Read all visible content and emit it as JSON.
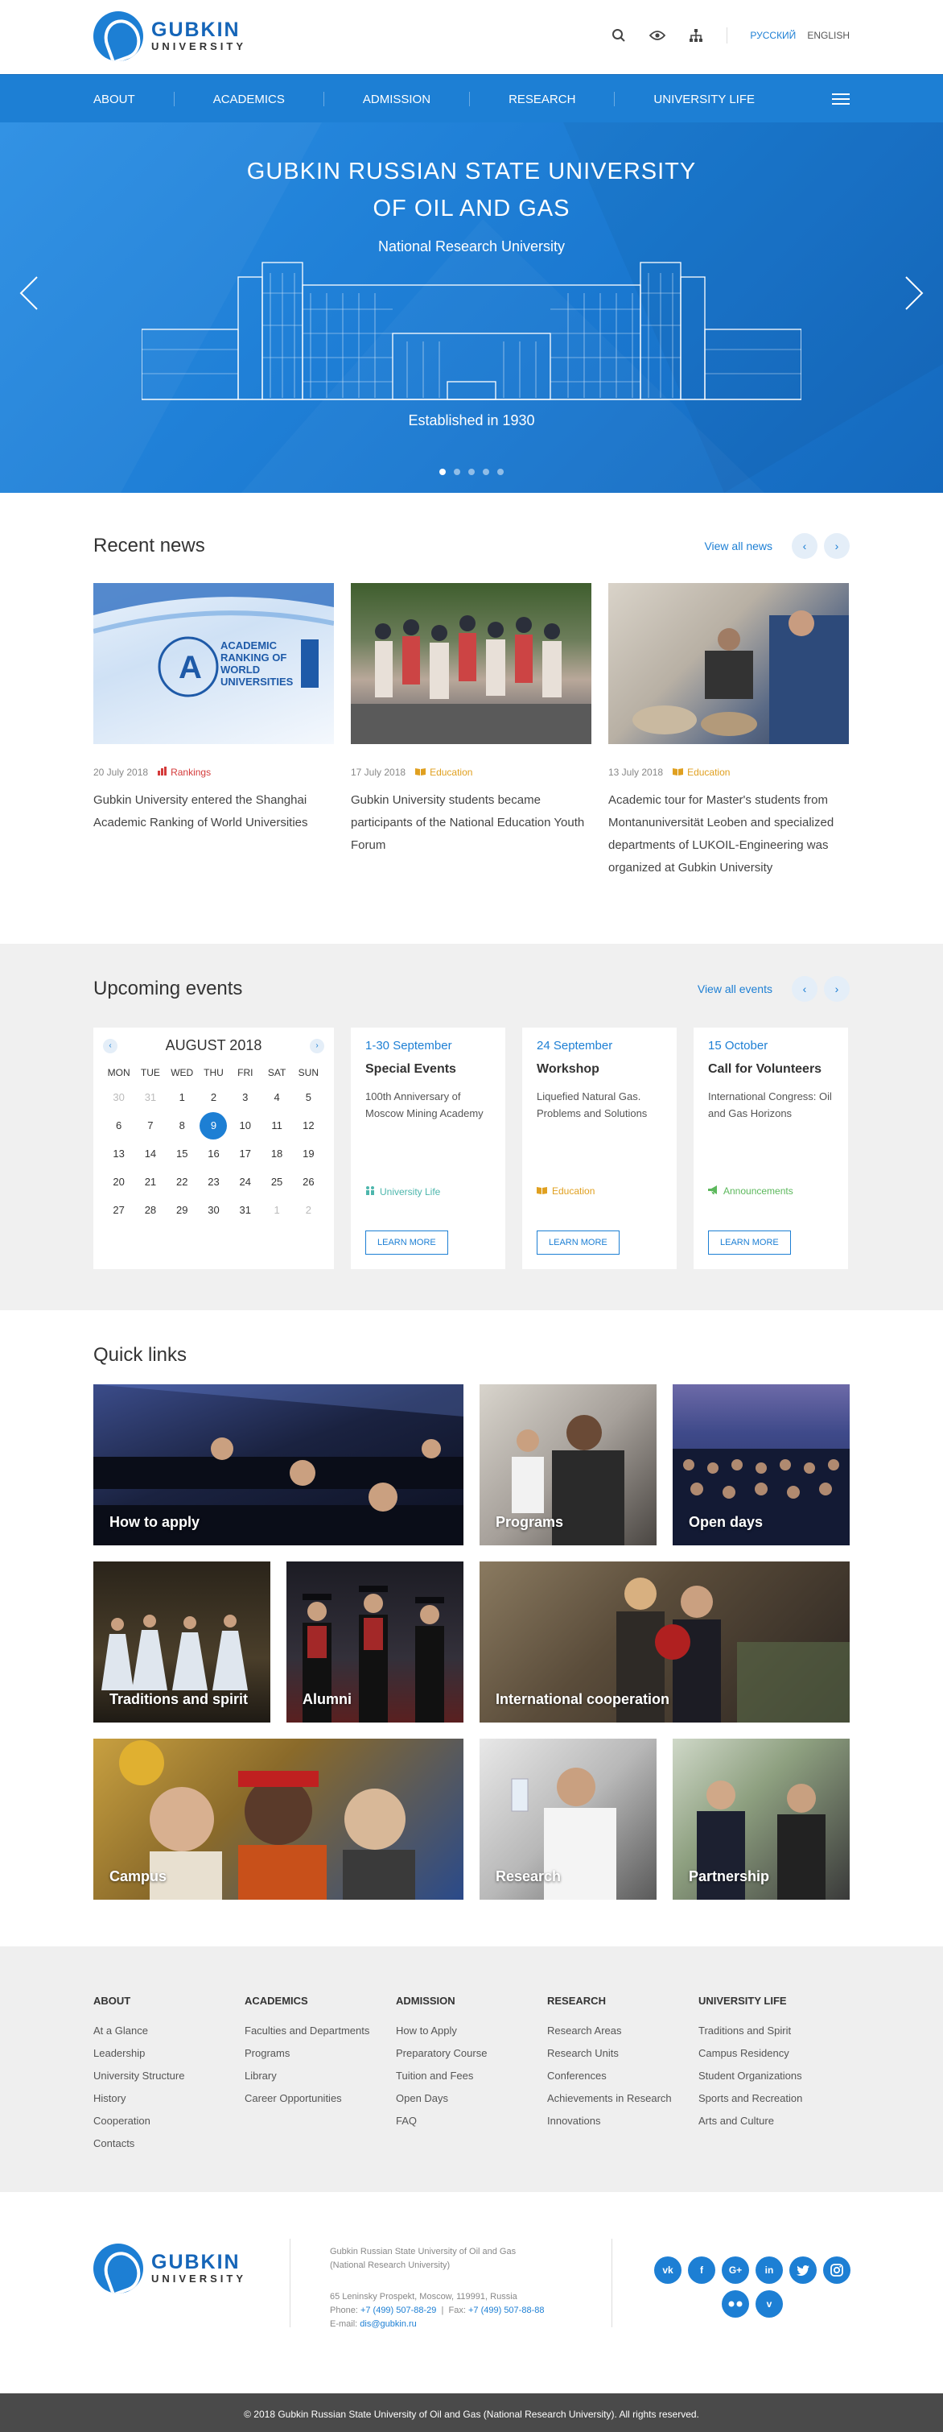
{
  "header": {
    "logo_line1": "GUBKIN",
    "logo_line2": "UNIVERSITY",
    "lang_ru": "РУССКИЙ",
    "lang_en": "ENGLISH"
  },
  "nav": [
    "ABOUT",
    "ACADEMICS",
    "ADMISSION",
    "RESEARCH",
    "UNIVERSITY LIFE"
  ],
  "hero": {
    "title_line1": "GUBKIN RUSSIAN STATE UNIVERSITY",
    "title_line2": "OF OIL AND GAS",
    "subtitle": "National Research University",
    "established": "Established in 1930",
    "slides": 5,
    "active_slide": 1
  },
  "news": {
    "heading": "Recent news",
    "view_all": "View all news",
    "items": [
      {
        "date": "20 July 2018",
        "category": "Rankings",
        "cat_color": "#d43a3a",
        "title": "Gubkin University entered the Shanghai Academic Ranking of World Universities",
        "img_text": "ACADEMIC RANKING OF WORLD UNIVERSITIES"
      },
      {
        "date": "17 July 2018",
        "category": "Education",
        "cat_color": "#e0a020",
        "title": "Gubkin University students became participants of the National Education Youth Forum"
      },
      {
        "date": "13 July 2018",
        "category": "Education",
        "cat_color": "#e0a020",
        "title": "Academic tour for Master's students from Montanuniversität Leoben and specialized departments of LUKOIL-Engineering was organized at Gubkin University"
      }
    ]
  },
  "events": {
    "heading": "Upcoming events",
    "view_all": "View all events",
    "calendar": {
      "month": "AUGUST 2018",
      "dow": [
        "MON",
        "TUE",
        "WED",
        "THU",
        "FRI",
        "SAT",
        "SUN"
      ],
      "days": [
        "30",
        "31",
        "1",
        "2",
        "3",
        "4",
        "5",
        "6",
        "7",
        "8",
        "9",
        "10",
        "11",
        "12",
        "13",
        "14",
        "15",
        "16",
        "17",
        "18",
        "19",
        "20",
        "21",
        "22",
        "23",
        "24",
        "25",
        "26",
        "27",
        "28",
        "29",
        "30",
        "31",
        "1",
        "2"
      ],
      "today": "9"
    },
    "items": [
      {
        "date": "1-30 September",
        "name": "Special Events",
        "desc": "100th Anniversary of Moscow Mining Academy",
        "category": "University Life",
        "cat_color": "#4db6ac",
        "button": "LEARN MORE"
      },
      {
        "date": "24 September",
        "name": "Workshop",
        "desc": "Liquefied Natural Gas. Problems and Solutions",
        "category": "Education",
        "cat_color": "#e0a020",
        "button": "LEARN MORE"
      },
      {
        "date": "15 October",
        "name": "Call for Volunteers",
        "desc": "International Congress: Oil and Gas Horizons",
        "category": "Announcements",
        "cat_color": "#5cb85c",
        "button": "LEARN MORE"
      }
    ]
  },
  "quick_links": {
    "heading": "Quick links",
    "items": [
      "How to apply",
      "Programs",
      "Open days",
      "Traditions and spirit",
      "Alumni",
      "International cooperation",
      "Campus",
      "Research",
      "Partnership"
    ]
  },
  "footer_nav": [
    {
      "title": "ABOUT",
      "links": [
        "At a Glance",
        "Leadership",
        "University Structure",
        "History",
        "Cooperation",
        "Contacts"
      ]
    },
    {
      "title": "ACADEMICS",
      "links": [
        "Faculties and Departments",
        "Programs",
        "Library",
        "Career Opportunities"
      ]
    },
    {
      "title": "ADMISSION",
      "links": [
        "How to Apply",
        "Preparatory Course",
        "Tuition and Fees",
        "Open Days",
        "FAQ"
      ]
    },
    {
      "title": "RESEARCH",
      "links": [
        "Research Areas",
        "Research Units",
        "Conferences",
        "Achievements in Research",
        "Innovations"
      ]
    },
    {
      "title": "UNIVERSITY LIFE",
      "links": [
        "Traditions and Spirit",
        "Campus Residency",
        "Student Organizations",
        "Sports and Recreation",
        "Arts and Culture"
      ]
    }
  ],
  "footer_info": {
    "org_line1": "Gubkin Russian State University of Oil and Gas",
    "org_line2": "(National Research University)",
    "address": "65 Leninsky Prospekt, Moscow, 119991, Russia",
    "phone_label": "Phone:",
    "phone": "+7 (499) 507-88-29",
    "fax_label": "Fax:",
    "fax": "+7 (499) 507-88-88",
    "email_label": "E-mail:",
    "email": "dis@gubkin.ru",
    "social": [
      "vk",
      "f",
      "G+",
      "in",
      "tw",
      "ig",
      "flickr",
      "v"
    ]
  },
  "copyright": "© 2018 Gubkin Russian State University of Oil and Gas (National Research University). All rights reserved."
}
